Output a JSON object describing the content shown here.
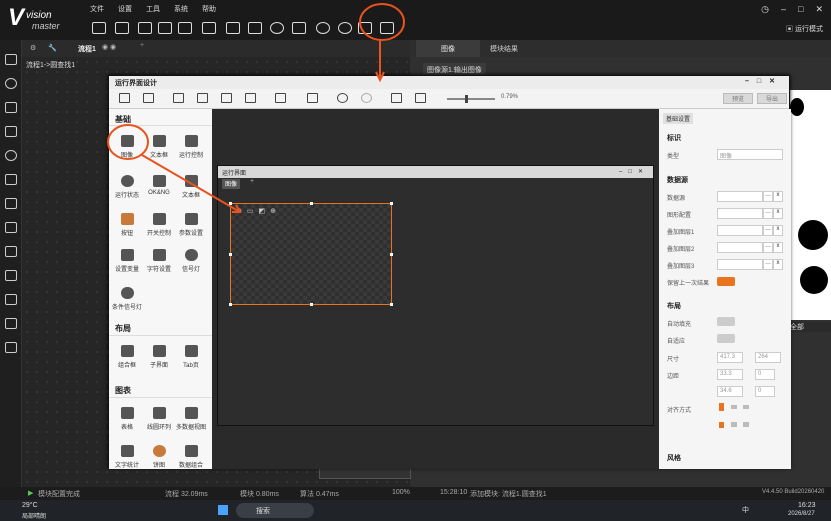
{
  "app": {
    "logo_main": "V",
    "logo_t1": "vision",
    "logo_t2": "master",
    "run_mode": "运行模式"
  },
  "menu": [
    "文件",
    "设置",
    "工具",
    "系统",
    "帮助"
  ],
  "flow": {
    "tab": "流程1",
    "breadcrumb": "流程1->圆查找1"
  },
  "right_tabs": {
    "image": "图像",
    "result": "模块结果",
    "source": "图像源1.输出图像"
  },
  "dialog": {
    "title": "运行界面设计",
    "zoom": "0.79%",
    "btn_preview": "预览",
    "btn_export": "导出"
  },
  "palette": {
    "sec_basic": "基础",
    "basic_items": [
      "图像",
      "文本框",
      "运行控制",
      "运行状态",
      "OK&NG",
      "文本框",
      "按钮",
      "开关控制",
      "参数设置",
      "设置变量",
      "字符设置",
      "信号灯",
      "条件信号灯"
    ],
    "sec_layout": "布局",
    "layout_items": [
      "组合框",
      "子界面",
      "Tab页"
    ],
    "sec_chart": "图表",
    "chart_items": [
      "表格",
      "线圆环列",
      "多数据视图",
      "文字统计",
      "饼图",
      "数据组合"
    ]
  },
  "inner": {
    "title": "运行界面",
    "tab": "图像"
  },
  "props": {
    "tab": "基础设置",
    "sec_label": "标识",
    "type_label": "类型",
    "type_value": "图像",
    "sec_source": "数据源",
    "source_rows": [
      "数据源",
      "图形配置",
      "叠加图层1",
      "叠加图层2",
      "叠加图层3"
    ],
    "keep_last": "保留上一次结果",
    "sec_layout": "布局",
    "auto_fill": "自动填充",
    "auto_fit": "自适应",
    "size_label": "尺寸",
    "size_w": "417.3",
    "size_h": "264",
    "margin_label": "边距",
    "m1": "33.3",
    "m2": "0",
    "m3": "34.6",
    "m4": "0",
    "align_label": "对齐方式",
    "sec_style": "风格"
  },
  "right_overlay": {
    "all": "全部"
  },
  "status": {
    "left": "模块配置完成",
    "flow_time": "流程 32.09ms",
    "mod_time": "模块 0.80ms",
    "algo_time": "算法 0.47ms",
    "zoom": "100%",
    "msg_time": "15:28:10",
    "msg": "添加模块: 流程1.圆查找1",
    "version": "V4.4.50 Build20260420"
  },
  "taskbar": {
    "weather": "29°C",
    "weather_desc": "局部晴朗",
    "search": "搜索",
    "ime": "中",
    "time": "16:23",
    "date": "2026/8/27"
  },
  "colors": {
    "accent": "#e8741e",
    "annotation": "#e8531e"
  }
}
